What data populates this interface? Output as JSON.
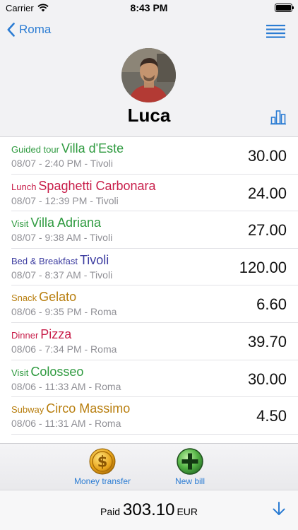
{
  "status_bar": {
    "carrier": "Carrier",
    "time": "8:43 PM"
  },
  "nav": {
    "back_label": "Roma",
    "back_icon": "chevron-left-icon",
    "menu_icon": "menu-icon"
  },
  "person": {
    "name": "Luca",
    "stats_icon": "bar-chart-icon"
  },
  "colors": {
    "accent": "#2b7cd3",
    "green": "#2e9a3f",
    "red": "#c81e4a",
    "indigo": "#3c3ca0",
    "gold": "#b87e0e"
  },
  "expenses": [
    {
      "category": "Guided tour",
      "name": "Villa d'Este",
      "when": "08/07 - 2:40 PM - Tivoli",
      "amount": "30.00",
      "color": "#2e9a3f"
    },
    {
      "category": "Lunch",
      "name": "Spaghetti Carbonara",
      "when": "08/07 - 12:39 PM - Tivoli",
      "amount": "24.00",
      "color": "#c81e4a"
    },
    {
      "category": "Visit",
      "name": "Villa Adriana",
      "when": "08/07 - 9:38 AM - Tivoli",
      "amount": "27.00",
      "color": "#2e9a3f"
    },
    {
      "category": "Bed & Breakfast",
      "name": "Tivoli",
      "when": "08/07 - 8:37 AM - Tivoli",
      "amount": "120.00",
      "color": "#3c3ca0"
    },
    {
      "category": "Snack",
      "name": "Gelato",
      "when": "08/06 - 9:35 PM - Roma",
      "amount": "6.60",
      "color": "#b87e0e"
    },
    {
      "category": "Dinner",
      "name": "Pizza",
      "when": "08/06 - 7:34 PM - Roma",
      "amount": "39.70",
      "color": "#c81e4a"
    },
    {
      "category": "Visit",
      "name": "Colosseo",
      "when": "08/06 - 11:33 AM - Roma",
      "amount": "30.00",
      "color": "#2e9a3f"
    },
    {
      "category": "Subway",
      "name": "Circo Massimo",
      "when": "08/06 - 11:31 AM - Roma",
      "amount": "4.50",
      "color": "#b87e0e"
    }
  ],
  "toolbar": {
    "money_transfer_label": "Money transfer",
    "money_transfer_icon": "dollar-coin-icon",
    "new_bill_label": "New bill",
    "new_bill_icon": "plus-circle-icon"
  },
  "footer": {
    "paid_label": "Paid",
    "total": "303.10",
    "currency": "EUR",
    "down_icon": "arrow-down-icon"
  }
}
